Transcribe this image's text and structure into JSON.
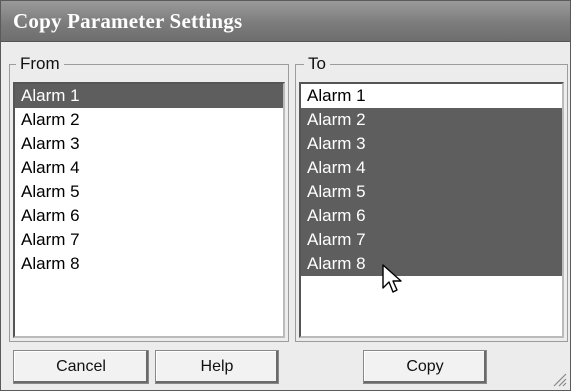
{
  "window": {
    "title": "Copy Parameter Settings"
  },
  "from_group": {
    "label": "From",
    "items": [
      "Alarm 1",
      "Alarm 2",
      "Alarm 3",
      "Alarm 4",
      "Alarm 5",
      "Alarm 6",
      "Alarm 7",
      "Alarm 8"
    ],
    "selected": [
      0
    ]
  },
  "to_group": {
    "label": "To",
    "items": [
      "Alarm 1",
      "Alarm 2",
      "Alarm 3",
      "Alarm 4",
      "Alarm 5",
      "Alarm 6",
      "Alarm 7",
      "Alarm 8"
    ],
    "selected": [
      1,
      2,
      3,
      4,
      5,
      6,
      7
    ]
  },
  "buttons": {
    "cancel": "Cancel",
    "help": "Help",
    "copy": "Copy"
  },
  "icons": {
    "cursor": "arrow-cursor-icon",
    "resize": "resize-grip-icon"
  },
  "colors": {
    "title_bar": "#7c7c7c",
    "selection": "#5e5e5e"
  }
}
